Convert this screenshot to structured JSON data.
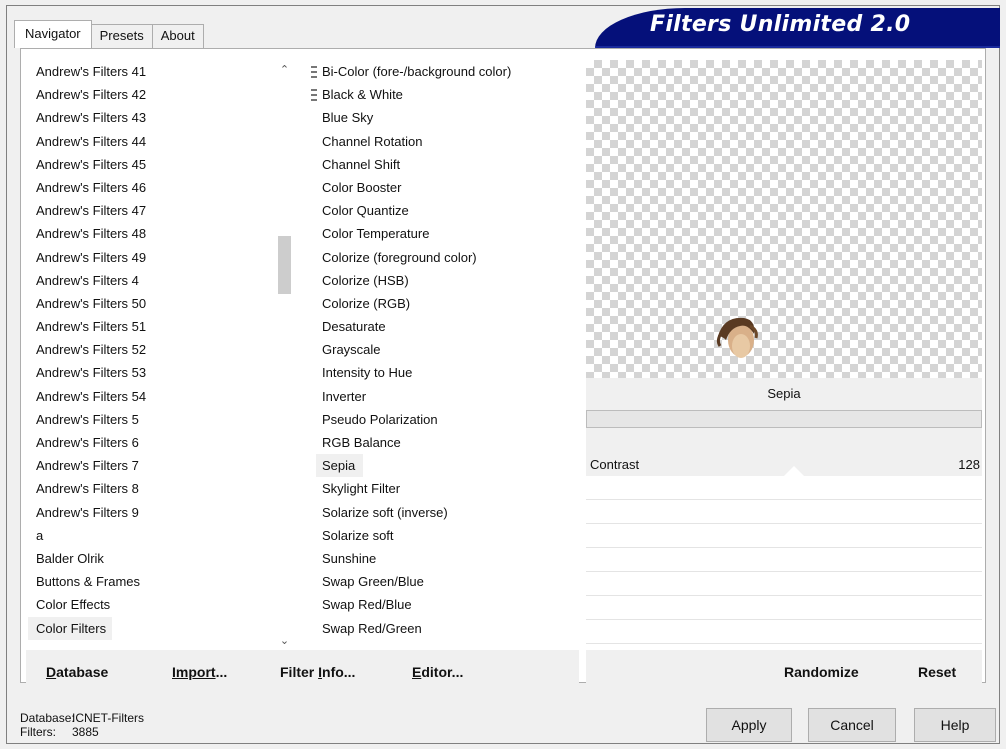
{
  "tabs": [
    "Navigator",
    "Presets",
    "About"
  ],
  "banner_title": "Filters Unlimited 2.0",
  "categories": [
    "Andrew's Filters 41",
    "Andrew's Filters 42",
    "Andrew's Filters 43",
    "Andrew's Filters 44",
    "Andrew's Filters 45",
    "Andrew's Filters 46",
    "Andrew's Filters 47",
    "Andrew's Filters 48",
    "Andrew's Filters 49",
    "Andrew's Filters 4",
    "Andrew's Filters 50",
    "Andrew's Filters 51",
    "Andrew's Filters 52",
    "Andrew's Filters 53",
    "Andrew's Filters 54",
    "Andrew's Filters 5",
    "Andrew's Filters 6",
    "Andrew's Filters 7",
    "Andrew's Filters 8",
    "Andrew's Filters 9",
    "a",
    "Balder Olrik",
    "Buttons & Frames",
    "Color Effects",
    "Color Filters"
  ],
  "selected_category": "Color Filters",
  "filters": [
    "Bi-Color (fore-/background color)",
    "Black & White",
    "Blue Sky",
    "Channel Rotation",
    "Channel Shift",
    "Color Booster",
    "Color Quantize",
    "Color Temperature",
    "Colorize (foreground color)",
    "Colorize (HSB)",
    "Colorize (RGB)",
    "Desaturate",
    "Grayscale",
    "Intensity to Hue",
    "Inverter",
    "Pseudo Polarization",
    "RGB Balance",
    "Sepia",
    "Skylight Filter",
    "Solarize soft (inverse)",
    "Solarize soft",
    "Sunshine",
    "Swap Green/Blue",
    "Swap Red/Blue",
    "Swap Red/Green"
  ],
  "selected_filter": "Sepia",
  "preview": {
    "filter_name": "Sepia"
  },
  "params": [
    {
      "label": "Contrast",
      "value": "128"
    }
  ],
  "toolbar": {
    "database_rest": "atabase",
    "database_key": "D",
    "import_pre": "Import",
    "import_key": "...",
    "filterinfo_pre": "Filter ",
    "filterinfo_key": "I",
    "filterinfo_rest": "nfo...",
    "editor_key": "E",
    "editor_rest": "ditor...",
    "randomize": "Randomize",
    "reset": "Reset"
  },
  "status": {
    "database_label": "Database:",
    "database_value": "ICNET-Filters",
    "filters_label": "Filters:",
    "filters_value": "3885"
  },
  "buttons": {
    "apply": "Apply",
    "cancel": "Cancel",
    "help": "Help"
  }
}
